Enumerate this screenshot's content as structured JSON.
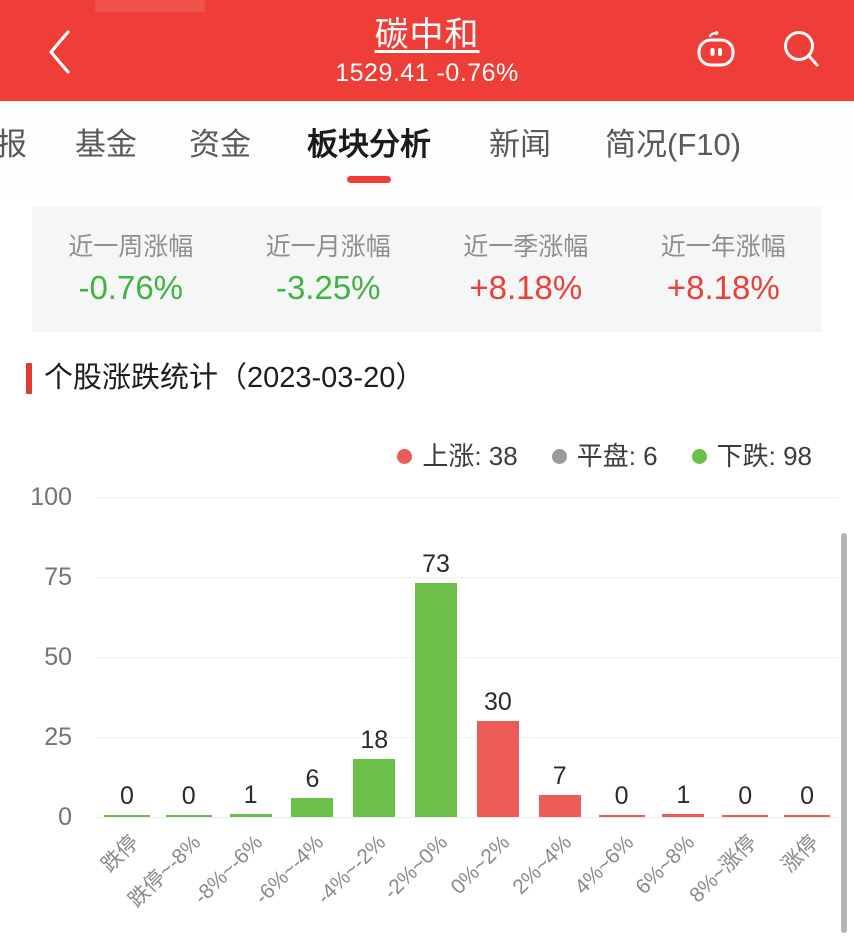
{
  "header": {
    "back_icon": "chevron-left-icon",
    "title": "碳中和",
    "subtitle": "1529.41 -0.76%",
    "robot_icon": "robot-assistant-icon",
    "search_icon": "search-icon",
    "bg_color": "#EE3E37"
  },
  "tabs": [
    {
      "label": "报",
      "active": false,
      "clipped": true
    },
    {
      "label": "基金",
      "active": false
    },
    {
      "label": "资金",
      "active": false
    },
    {
      "label": "板块分析",
      "active": true
    },
    {
      "label": "新闻",
      "active": false
    },
    {
      "label": "简况(F10)",
      "active": false
    }
  ],
  "stats": [
    {
      "label": "近一周涨幅",
      "value": "-0.76%",
      "dir": "down"
    },
    {
      "label": "近一月涨幅",
      "value": "-3.25%",
      "dir": "down"
    },
    {
      "label": "近一季涨幅",
      "value": "+8.18%",
      "dir": "up"
    },
    {
      "label": "近一年涨幅",
      "value": "+8.18%",
      "dir": "up"
    }
  ],
  "section": {
    "title": "个股涨跌统计（2023-03-20）"
  },
  "legend": [
    {
      "label": "上涨: 38",
      "color": "#EC5B56"
    },
    {
      "label": "平盘: 6",
      "color": "#9b9b9b"
    },
    {
      "label": "下跌: 98",
      "color": "#6BC04A"
    }
  ],
  "colors": {
    "up_red": "#EC5B56",
    "down_green": "#6BC04A",
    "flat_gray": "#9b9b9b",
    "brand_red": "#EE3E37"
  },
  "chart_data": {
    "type": "bar",
    "title": "个股涨跌统计（2023-03-20）",
    "xlabel": "",
    "ylabel": "",
    "ylim": [
      0,
      100
    ],
    "yticks": [
      100,
      75,
      50,
      25,
      0
    ],
    "grid": true,
    "legend_position": "top-right",
    "categories": [
      "跌停",
      "跌停~-8%",
      "-8%~-6%",
      "-6%~-4%",
      "-4%~-2%",
      "-2%~0%",
      "0%~2%",
      "2%~4%",
      "4%~6%",
      "6%~8%",
      "8%~涨停",
      "涨停"
    ],
    "values": [
      0,
      0,
      1,
      6,
      18,
      73,
      30,
      7,
      0,
      1,
      0,
      0
    ],
    "bar_colors": [
      "#6BC04A",
      "#6BC04A",
      "#6BC04A",
      "#6BC04A",
      "#6BC04A",
      "#6BC04A",
      "#EC5B56",
      "#EC5B56",
      "#EC5B56",
      "#EC5B56",
      "#EC5B56",
      "#EC5B56"
    ],
    "annotations": [
      "0",
      "0",
      "1",
      "6",
      "18",
      "73",
      "30",
      "7",
      "0",
      "1",
      "0",
      "0"
    ],
    "legend_entries": [
      "上涨: 38",
      "平盘: 6",
      "下跌: 98"
    ]
  }
}
